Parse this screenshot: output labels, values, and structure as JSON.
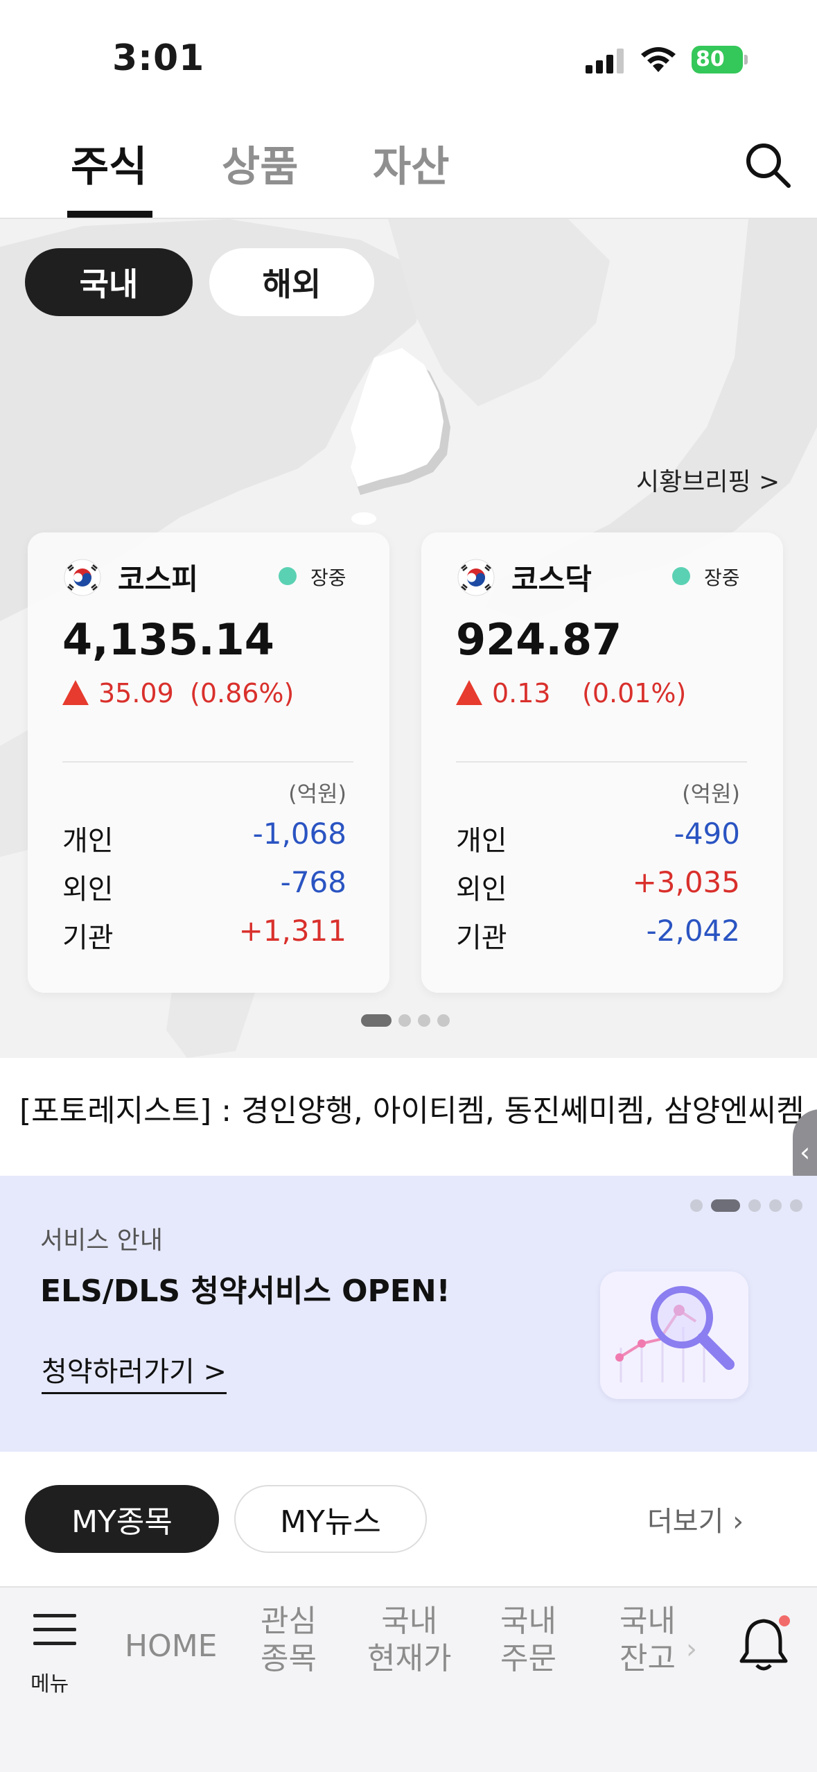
{
  "status_bar": {
    "time": "3:01",
    "battery": "80"
  },
  "top_tabs": {
    "tabs": [
      "주식",
      "상품",
      "자산"
    ],
    "active": "주식"
  },
  "market_toggle": {
    "domestic": "국내",
    "overseas": "해외",
    "active": "국내"
  },
  "briefing_link": "시황브리핑 >",
  "cards": [
    {
      "name": "코스피",
      "status": "장중",
      "value": "4,135.14",
      "change": "35.09",
      "change_pct": "(0.86%)",
      "unit": "(억원)",
      "rows": [
        {
          "label": "개인",
          "value": "-1,068"
        },
        {
          "label": "외인",
          "value": "-768"
        },
        {
          "label": "기관",
          "value": "+1,311"
        }
      ]
    },
    {
      "name": "코스닥",
      "status": "장중",
      "value": "924.87",
      "change": "0.13",
      "change_pct": "(0.01%)",
      "unit": "(억원)",
      "rows": [
        {
          "label": "개인",
          "value": "-490"
        },
        {
          "label": "외인",
          "value": "+3,035"
        },
        {
          "label": "기관",
          "value": "-2,042"
        }
      ]
    }
  ],
  "card_pager": {
    "count": 4,
    "active": 1
  },
  "ticker": "[포토레지스트] : 경인양행, 아이티켐, 동진쎄미켐, 삼양엔씨켐,",
  "banner": {
    "small": "서비스 안내",
    "title": "ELS/DLS 청약서비스 OPEN!",
    "link": "청약하러가기 >",
    "pager": {
      "count": 5,
      "active": 2
    }
  },
  "my_tabs": {
    "stock": "MY종목",
    "news": "MY뉴스",
    "more": "더보기 ›"
  },
  "bottom_nav": {
    "menu": "메뉴",
    "home": "HOME",
    "items": [
      {
        "line1": "관심",
        "line2": "종목"
      },
      {
        "line1": "국내",
        "line2": "현재가"
      },
      {
        "line1": "국내",
        "line2": "주문"
      },
      {
        "line1": "국내",
        "line2": "잔고"
      }
    ]
  },
  "colors": {
    "up": "#d9302c",
    "down": "#2a54c2",
    "status_dot": "#5bd1b3",
    "battery": "#34c759"
  }
}
